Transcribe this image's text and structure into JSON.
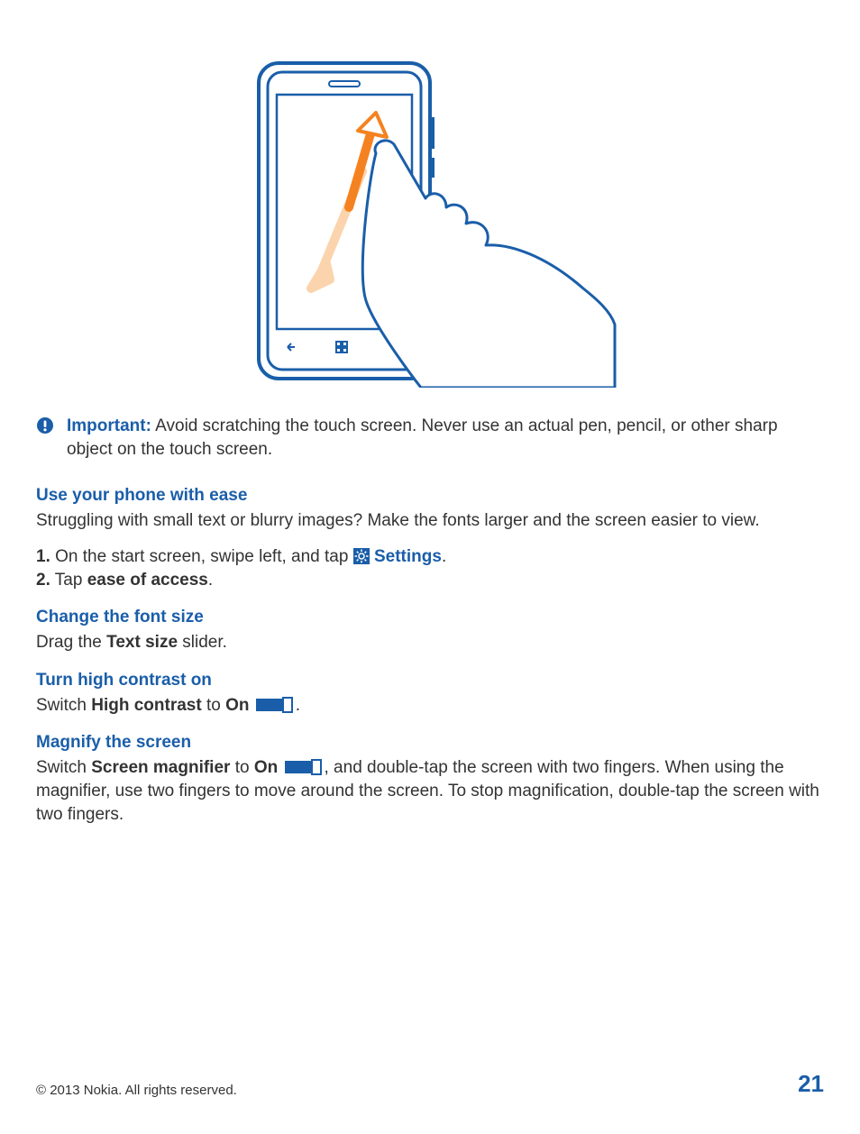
{
  "important": {
    "label": "Important:",
    "text": " Avoid scratching the touch screen. Never use an actual pen, pencil, or other sharp object on the touch screen."
  },
  "section": {
    "title": "Use your phone with ease",
    "intro": "Struggling with small text or blurry images? Make the fonts larger and the screen easier to view.",
    "step1_num": "1.",
    "step1_a": " On the start screen, swipe left, and tap ",
    "step1_settings": "Settings",
    "step1_end": ".",
    "step2_num": "2.",
    "step2_a": " Tap ",
    "step2_b": "ease of access",
    "step2_end": "."
  },
  "font": {
    "title": "Change the font size",
    "a": "Drag the ",
    "b": "Text size",
    "c": " slider."
  },
  "contrast": {
    "title": "Turn high contrast on",
    "a": "Switch ",
    "b": "High contrast",
    "c": " to ",
    "d": "On",
    "end": "."
  },
  "magnify": {
    "title": "Magnify the screen",
    "a": "Switch ",
    "b": "Screen magnifier",
    "c": " to ",
    "d": "On",
    "e": ", and double-tap the screen with two fingers. When using the magnifier, use two fingers to move around the screen. To stop magnification, double-tap the screen with two fingers."
  },
  "footer": {
    "copyright": "© 2013 Nokia. All rights reserved.",
    "page": "21"
  }
}
